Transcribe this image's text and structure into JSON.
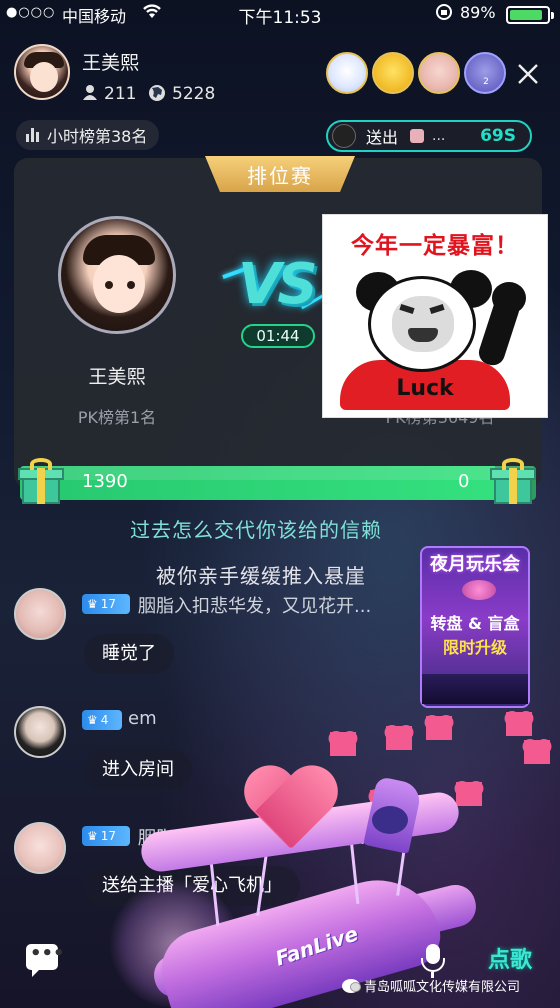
{
  "status_bar": {
    "signal": "●○○○",
    "carrier": "中国移动",
    "wifi_icon": "wifi-icon",
    "time": "下午11:53",
    "battery": "89%",
    "battery_level": 0.89
  },
  "host": {
    "name": "王美熙",
    "followers": "211",
    "viewers": "5228"
  },
  "top_fans": [
    {
      "badge": ""
    },
    {
      "badge": ""
    },
    {
      "badge": ""
    },
    {
      "badge": "2"
    }
  ],
  "rank_pill": {
    "label": "小时榜第38名"
  },
  "gift_notice": {
    "send_label": "送出",
    "ellipsis": "...",
    "timer": "69S"
  },
  "pk": {
    "banner": "排位赛",
    "vs": "VS",
    "timer": "01:44",
    "host_name": "王美熙",
    "host_rank": "PK榜第1名",
    "opponent_rank": "PK榜第3649名",
    "score_left": "1390",
    "score_right": "0",
    "score_left_fraction": 0.92
  },
  "sticker": {
    "title": "今年一定暴富！",
    "shirt_text": "Luck"
  },
  "lyrics": [
    "过去怎么交代你该给的信赖",
    "被你亲手缓缓推入悬崖"
  ],
  "chat": [
    {
      "level": "17",
      "user": "胭脂入扣悲华发，又见花开...",
      "message": "睡觉了"
    },
    {
      "level": "4",
      "user": "em",
      "message": "进入房间"
    },
    {
      "level": "17",
      "user": "胭脂入扣悲华发，又见花开...",
      "message": "送给主播「爱心飞机」"
    }
  ],
  "event": {
    "title": "夜月玩乐会",
    "line1": "转盘 & 盲盒",
    "line2": "限时升级"
  },
  "plane": {
    "logo": "FanLive"
  },
  "bottom_bar": {
    "chat_dots": "•••",
    "song": "点歌"
  },
  "watermark": {
    "text": "青岛呱呱文化传媒有限公司"
  }
}
